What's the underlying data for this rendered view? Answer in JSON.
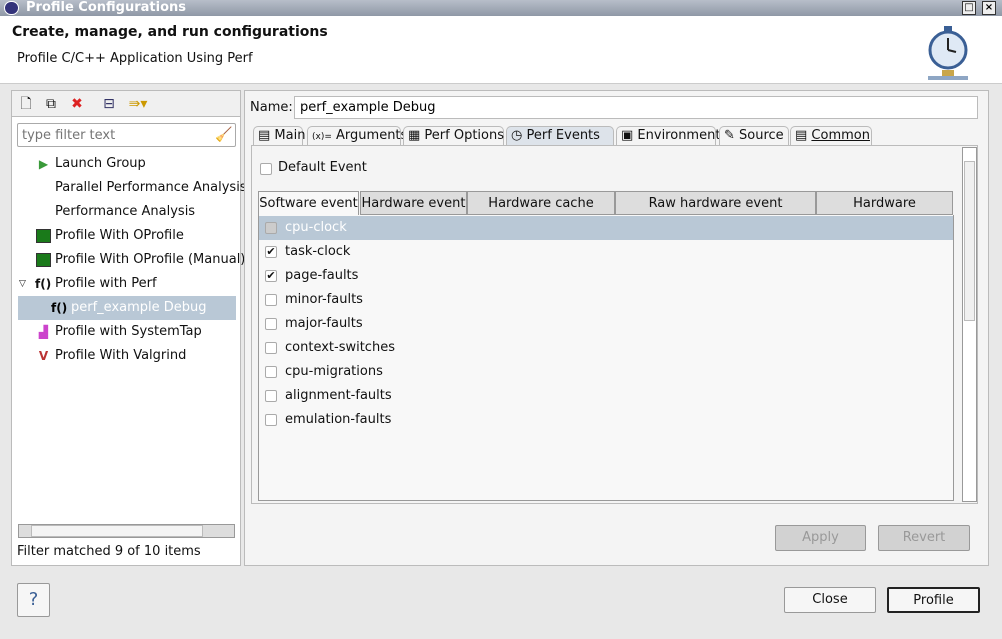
{
  "window": {
    "title": "Profile Configurations"
  },
  "header": {
    "title": "Create, manage, and run configurations",
    "subtitle": "Profile C/C++ Application Using Perf"
  },
  "left": {
    "filter_placeholder": "type filter text",
    "tree": [
      {
        "label": "Launch Group",
        "icon": "launch-group-icon"
      },
      {
        "label": "Parallel Performance Analysis",
        "icon": ""
      },
      {
        "label": "Performance Analysis",
        "icon": ""
      },
      {
        "label": "Profile With OProfile",
        "icon": "oprofile-icon"
      },
      {
        "label": "Profile With OProfile (Manual)",
        "icon": "oprofile-manual-icon"
      },
      {
        "label": "Profile with Perf",
        "icon": "perf-icon",
        "expanded": true
      },
      {
        "label": "perf_example Debug",
        "icon": "perf-icon",
        "selected": true
      },
      {
        "label": "Profile with SystemTap",
        "icon": "systemtap-icon"
      },
      {
        "label": "Profile With Valgrind",
        "icon": "valgrind-icon"
      }
    ],
    "status": "Filter matched 9 of 10 items"
  },
  "right": {
    "name_label": "Name:",
    "name_value": "perf_example Debug",
    "tabs": [
      "Main",
      "Arguments",
      "Perf Options",
      "Perf Events",
      "Environment",
      "Source",
      "Common"
    ],
    "active_tab": "Perf Events",
    "default_event": {
      "label": "Default Event",
      "checked": false
    },
    "event_tabs": [
      "Software event",
      "Hardware event",
      "Hardware cache event",
      "Raw hardware event descriptor",
      "Hardware breakpoint"
    ],
    "events": [
      {
        "label": "cpu-clock",
        "checked": false,
        "selected": true
      },
      {
        "label": "task-clock",
        "checked": true
      },
      {
        "label": "page-faults",
        "checked": true
      },
      {
        "label": "minor-faults",
        "checked": false
      },
      {
        "label": "major-faults",
        "checked": false
      },
      {
        "label": "context-switches",
        "checked": false
      },
      {
        "label": "cpu-migrations",
        "checked": false
      },
      {
        "label": "alignment-faults",
        "checked": false
      },
      {
        "label": "emulation-faults",
        "checked": false
      }
    ],
    "apply": "Apply",
    "revert": "Revert"
  },
  "footer": {
    "close": "Close",
    "profile": "Profile",
    "help": "?"
  }
}
